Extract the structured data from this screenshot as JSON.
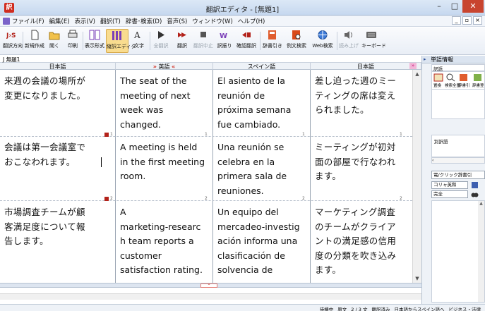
{
  "window": {
    "title": "翻訳エディタ - [無題1]",
    "min": "–",
    "max": "□",
    "close": "✕"
  },
  "menu": {
    "items": [
      "ファイル(F)",
      "編集(E)",
      "表示(V)",
      "翻訳(T)",
      "辞書･検索(D)",
      "音声(S)",
      "ウィンドウ(W)",
      "ヘルプ(H)"
    ],
    "mdi": [
      "_",
      "▫",
      "×"
    ]
  },
  "toolbar": {
    "items": [
      {
        "label": "翻訳方向",
        "icon": "direction-icon",
        "dim": false
      },
      {
        "label": "新規作成",
        "icon": "new-document-icon",
        "dim": false
      },
      {
        "label": "開く",
        "icon": "open-folder-icon",
        "dim": false
      },
      {
        "label": "印刷",
        "icon": "print-icon",
        "dim": false
      },
      {
        "label": "表示形式",
        "icon": "display-format-icon",
        "dim": false
      },
      {
        "label": "縦訳エディタ",
        "icon": "vertical-editor-icon",
        "dim": false
      },
      {
        "label": "文字",
        "icon": "font-icon",
        "dim": false
      },
      {
        "label": "全翻訳",
        "icon": "translate-all-icon",
        "dim": true
      },
      {
        "label": "翻訳",
        "icon": "translate-icon",
        "dim": false
      },
      {
        "label": "翻訳中止",
        "icon": "stop-icon",
        "dim": true
      },
      {
        "label": "訳振り",
        "icon": "ruby-translation-icon",
        "dim": false
      },
      {
        "label": "確認翻訳",
        "icon": "verify-translation-icon",
        "dim": false
      },
      {
        "label": "辞書引き",
        "icon": "dictionary-lookup-icon",
        "dim": false
      },
      {
        "label": "例文検索",
        "icon": "example-search-icon",
        "dim": false
      },
      {
        "label": "Web検索",
        "icon": "web-search-icon",
        "dim": false
      },
      {
        "label": "読み上げ",
        "icon": "read-aloud-icon",
        "dim": true
      },
      {
        "label": "キーボード",
        "icon": "keyboard-icon",
        "dim": false
      }
    ]
  },
  "document": {
    "tab_label": "J 無題1",
    "columns": [
      {
        "header": "日本語"
      },
      {
        "header": "英語",
        "arrow_left": "»",
        "arrow_right": "«"
      },
      {
        "header": "スペイン語"
      },
      {
        "header": "日本語",
        "switch": "»"
      }
    ],
    "rows": [
      {
        "ja": [
          "来週の会議の場所が",
          "変更になりました。"
        ],
        "en": [
          "The seat of the",
          "meeting of next",
          "week was",
          "changed."
        ],
        "es": [
          "El asiento de la",
          "reunión de",
          "próxima semana",
          "fue cambiado."
        ],
        "ja2": [
          "差し迫った週のミー",
          "ティングの席は変え",
          "られました。"
        ],
        "num_es": "1",
        "num_ja2": "1"
      },
      {
        "ja": [
          "会議は第一会議室で",
          "おこなわれます。"
        ],
        "en": [
          "A meeting is held",
          "in the first meeting",
          "room."
        ],
        "es": [
          "Una reunión se",
          "celebra en la",
          "primera sala de",
          "reuniones."
        ],
        "ja2": [
          "ミーティングが初対",
          "面の部屋で行なわれ",
          "ます。"
        ],
        "num_ja": "1",
        "num_en": "1",
        "num_es": "2",
        "num_ja2": "2"
      },
      {
        "ja": [
          "市場調査チームが顧",
          "客満足度について報",
          "告します。"
        ],
        "en": [
          "A",
          "marketing-researc",
          "h team reports a",
          "customer",
          "satisfaction rating."
        ],
        "es": [
          "Un equipo del",
          "mercadeo-investig",
          "ación informa una",
          "clasificación de",
          "solvencia de"
        ],
        "ja2": [
          "マーケティング調査",
          "のチームがクライア",
          "ントの満足感の信用",
          "度の分類を吹き込み",
          "ます。"
        ],
        "num_ja": "2",
        "num_en": "2"
      }
    ]
  },
  "right_pane": {
    "title": "単語情報",
    "expander": "▸",
    "sub_label": "訳語",
    "ribbon": [
      {
        "label": "置換",
        "icon": "replace-icon"
      },
      {
        "label": "検索全置",
        "icon": "search-all-icon"
      },
      {
        "label": "辞書引",
        "icon": "dictionary-icon"
      },
      {
        "label": "辞書登",
        "icon": "register-icon"
      }
    ],
    "alt_label": "別訳語",
    "search_checkbox": "電/クリック辞書引",
    "dict_select": "コリャ英和",
    "match_select": "完全"
  },
  "status": {
    "items": [
      "待機中",
      "原文",
      "2 / 3 文",
      "翻訳済み",
      "日本語からスペイン語へ",
      "ビジネス・法律"
    ]
  },
  "colors": {
    "accent": "#d02c1f",
    "active_tool": "#f9dc8f",
    "title_bar": "#dce8f6"
  }
}
